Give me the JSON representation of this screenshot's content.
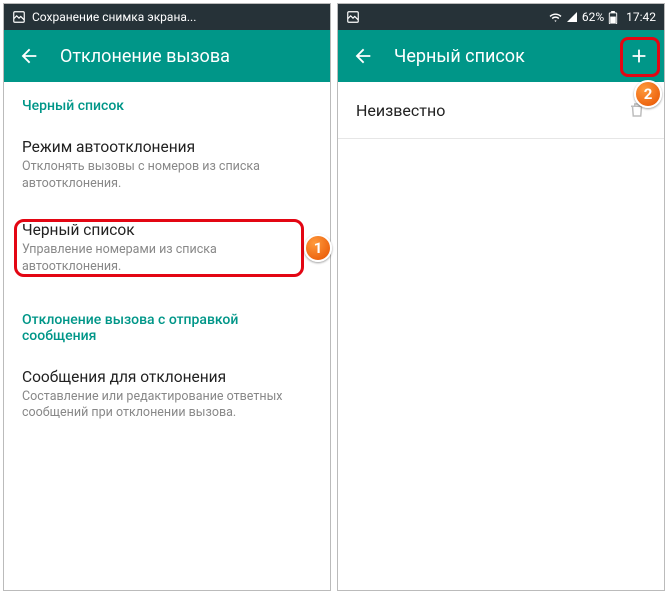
{
  "left": {
    "status": {
      "text": "Сохранение снимка экрана..."
    },
    "appbar": {
      "title": "Отклонение вызова"
    },
    "sections": {
      "blacklist_label": "Черный список",
      "auto_reject": {
        "title": "Режим автоотклонения",
        "subtitle": "Отклонять вызовы с номеров из списка автоотклонения."
      },
      "blacklist_item": {
        "title": "Черный список",
        "subtitle": "Управление номерами из списка автоотклонения."
      },
      "reject_with_msg_label": "Отклонение вызова с отправкой сообщения",
      "reject_messages": {
        "title": "Сообщения для отклонения",
        "subtitle": "Составление или редактирование ответных сообщений при отклонении вызова."
      }
    }
  },
  "right": {
    "status": {
      "battery": "62%",
      "time": "17:42"
    },
    "appbar": {
      "title": "Черный список"
    },
    "list": {
      "unknown": "Неизвестно"
    }
  },
  "callouts": {
    "one": "1",
    "two": "2"
  }
}
